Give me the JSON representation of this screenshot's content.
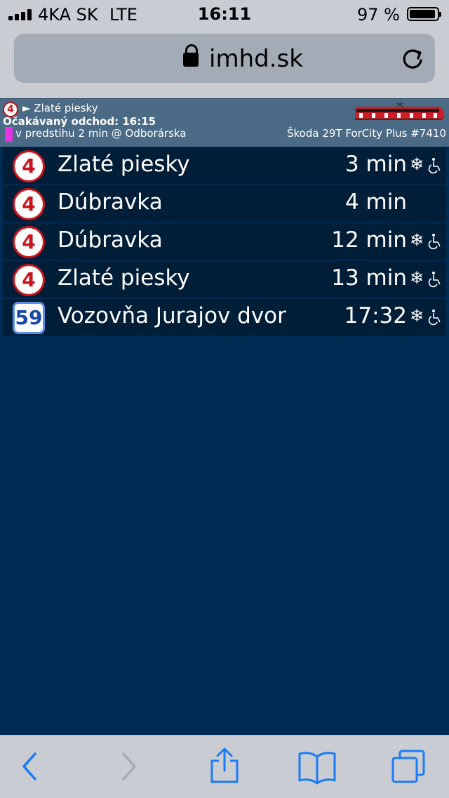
{
  "status": {
    "carrier": "4KA SK",
    "network": "LTE",
    "time": "16:11",
    "battery_pct": "97 %",
    "battery_level": 0.97
  },
  "browser": {
    "url": "imhd.sk",
    "icons": [
      "lock-icon",
      "reload-icon"
    ]
  },
  "info": {
    "line": "4",
    "destination": "► Zlaté piesky",
    "expected": "Očakávaný odchod: 16:15",
    "ahead": "v predstihu 2 min @ Odborárska",
    "vehicle": "Škoda 29T ForCity Plus #7410"
  },
  "departures": [
    {
      "line": "4",
      "type": "tram",
      "destination": "Zlaté piesky",
      "eta": "3 min",
      "ac": true,
      "accessible": true
    },
    {
      "line": "4",
      "type": "tram",
      "destination": "Dúbravka",
      "eta": "4 min",
      "ac": false,
      "accessible": false
    },
    {
      "line": "4",
      "type": "tram",
      "destination": "Dúbravka",
      "eta": "12 min",
      "ac": true,
      "accessible": true
    },
    {
      "line": "4",
      "type": "tram",
      "destination": "Zlaté piesky",
      "eta": "13 min",
      "ac": true,
      "accessible": true
    },
    {
      "line": "59",
      "type": "bus",
      "destination": "Vozovňa Jurajov dvor",
      "eta": "17:32",
      "ac": true,
      "accessible": true
    }
  ],
  "colors": {
    "page_bg": "#002b52",
    "row_bg": "#001e38",
    "header_bg": "#4a6a86",
    "tram_red": "#c8151d",
    "bus_blue": "#5b8ee6",
    "ios_blue": "#1a7cf5"
  },
  "toolbar": {
    "icons": [
      "back-icon",
      "forward-icon",
      "share-icon",
      "bookmarks-icon",
      "tabs-icon"
    ]
  }
}
